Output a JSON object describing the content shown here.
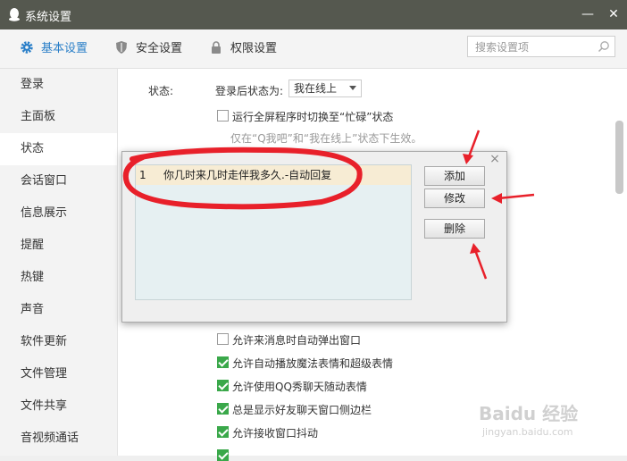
{
  "window": {
    "title": "系统设置",
    "minimize_glyph": "—",
    "close_glyph": "✕"
  },
  "toolbar": {
    "tabs": [
      {
        "label": "基本设置",
        "icon": "gear-icon",
        "active": true
      },
      {
        "label": "安全设置",
        "icon": "shield-icon",
        "active": false
      },
      {
        "label": "权限设置",
        "icon": "lock-icon",
        "active": false
      }
    ],
    "search_placeholder": "搜索设置项"
  },
  "sidebar": {
    "items": [
      {
        "label": "登录"
      },
      {
        "label": "主面板"
      },
      {
        "label": "状态",
        "active": true
      },
      {
        "label": "会话窗口"
      },
      {
        "label": "信息展示"
      },
      {
        "label": "提醒"
      },
      {
        "label": "热键"
      },
      {
        "label": "声音"
      },
      {
        "label": "软件更新"
      },
      {
        "label": "文件管理"
      },
      {
        "label": "文件共享"
      },
      {
        "label": "音视频通话"
      }
    ]
  },
  "content": {
    "section_label": "状态:",
    "login_status_label": "登录后状态为:",
    "login_status_value": "我在线上",
    "fullscreen_option": "运行全屏程序时切换至“忙碌”状态",
    "fullscreen_note": "仅在“Q我吧”和“我在线上”状态下生效。",
    "options": [
      {
        "label": "允许来消息时自动弹出窗口",
        "checked": false
      },
      {
        "label": "允许自动播放魔法表情和超级表情",
        "checked": true
      },
      {
        "label": "允许使用QQ秀聊天随动表情",
        "checked": true
      },
      {
        "label": "总是显示好友聊天窗口侧边栏",
        "checked": true
      },
      {
        "label": "允许接收窗口抖动",
        "checked": true
      }
    ]
  },
  "dialog": {
    "close_glyph": "×",
    "rows": [
      {
        "num": "1",
        "text": "你几时来几时走伴我多久.-自动回复"
      }
    ],
    "add_label": "添加",
    "edit_label": "修改",
    "delete_label": "删除"
  },
  "watermark": {
    "brand": "Baidu 经验",
    "url": "jingyan.baidu.com"
  },
  "colors": {
    "accent": "#2a7fc8",
    "titlebar": "#55584f",
    "annotation": "#e8202a",
    "check": "#3aa84a"
  }
}
